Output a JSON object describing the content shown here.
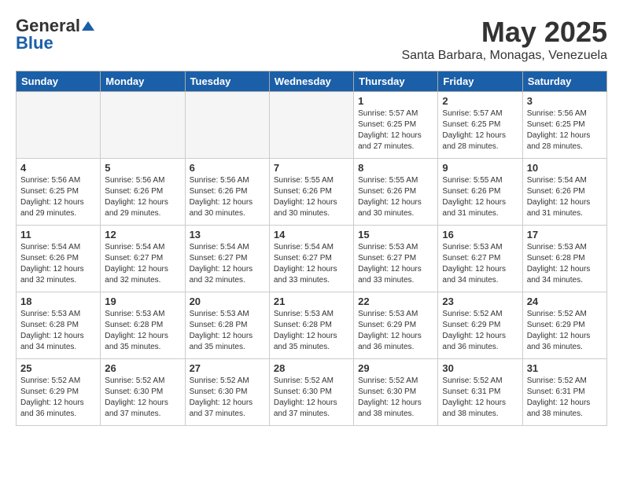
{
  "header": {
    "logo_general": "General",
    "logo_blue": "Blue",
    "month_title": "May 2025",
    "location": "Santa Barbara, Monagas, Venezuela"
  },
  "days_of_week": [
    "Sunday",
    "Monday",
    "Tuesday",
    "Wednesday",
    "Thursday",
    "Friday",
    "Saturday"
  ],
  "weeks": [
    [
      {
        "day": "",
        "info": ""
      },
      {
        "day": "",
        "info": ""
      },
      {
        "day": "",
        "info": ""
      },
      {
        "day": "",
        "info": ""
      },
      {
        "day": "1",
        "info": "Sunrise: 5:57 AM\nSunset: 6:25 PM\nDaylight: 12 hours\nand 27 minutes."
      },
      {
        "day": "2",
        "info": "Sunrise: 5:57 AM\nSunset: 6:25 PM\nDaylight: 12 hours\nand 28 minutes."
      },
      {
        "day": "3",
        "info": "Sunrise: 5:56 AM\nSunset: 6:25 PM\nDaylight: 12 hours\nand 28 minutes."
      }
    ],
    [
      {
        "day": "4",
        "info": "Sunrise: 5:56 AM\nSunset: 6:25 PM\nDaylight: 12 hours\nand 29 minutes."
      },
      {
        "day": "5",
        "info": "Sunrise: 5:56 AM\nSunset: 6:26 PM\nDaylight: 12 hours\nand 29 minutes."
      },
      {
        "day": "6",
        "info": "Sunrise: 5:56 AM\nSunset: 6:26 PM\nDaylight: 12 hours\nand 30 minutes."
      },
      {
        "day": "7",
        "info": "Sunrise: 5:55 AM\nSunset: 6:26 PM\nDaylight: 12 hours\nand 30 minutes."
      },
      {
        "day": "8",
        "info": "Sunrise: 5:55 AM\nSunset: 6:26 PM\nDaylight: 12 hours\nand 30 minutes."
      },
      {
        "day": "9",
        "info": "Sunrise: 5:55 AM\nSunset: 6:26 PM\nDaylight: 12 hours\nand 31 minutes."
      },
      {
        "day": "10",
        "info": "Sunrise: 5:54 AM\nSunset: 6:26 PM\nDaylight: 12 hours\nand 31 minutes."
      }
    ],
    [
      {
        "day": "11",
        "info": "Sunrise: 5:54 AM\nSunset: 6:26 PM\nDaylight: 12 hours\nand 32 minutes."
      },
      {
        "day": "12",
        "info": "Sunrise: 5:54 AM\nSunset: 6:27 PM\nDaylight: 12 hours\nand 32 minutes."
      },
      {
        "day": "13",
        "info": "Sunrise: 5:54 AM\nSunset: 6:27 PM\nDaylight: 12 hours\nand 32 minutes."
      },
      {
        "day": "14",
        "info": "Sunrise: 5:54 AM\nSunset: 6:27 PM\nDaylight: 12 hours\nand 33 minutes."
      },
      {
        "day": "15",
        "info": "Sunrise: 5:53 AM\nSunset: 6:27 PM\nDaylight: 12 hours\nand 33 minutes."
      },
      {
        "day": "16",
        "info": "Sunrise: 5:53 AM\nSunset: 6:27 PM\nDaylight: 12 hours\nand 34 minutes."
      },
      {
        "day": "17",
        "info": "Sunrise: 5:53 AM\nSunset: 6:28 PM\nDaylight: 12 hours\nand 34 minutes."
      }
    ],
    [
      {
        "day": "18",
        "info": "Sunrise: 5:53 AM\nSunset: 6:28 PM\nDaylight: 12 hours\nand 34 minutes."
      },
      {
        "day": "19",
        "info": "Sunrise: 5:53 AM\nSunset: 6:28 PM\nDaylight: 12 hours\nand 35 minutes."
      },
      {
        "day": "20",
        "info": "Sunrise: 5:53 AM\nSunset: 6:28 PM\nDaylight: 12 hours\nand 35 minutes."
      },
      {
        "day": "21",
        "info": "Sunrise: 5:53 AM\nSunset: 6:28 PM\nDaylight: 12 hours\nand 35 minutes."
      },
      {
        "day": "22",
        "info": "Sunrise: 5:53 AM\nSunset: 6:29 PM\nDaylight: 12 hours\nand 36 minutes."
      },
      {
        "day": "23",
        "info": "Sunrise: 5:52 AM\nSunset: 6:29 PM\nDaylight: 12 hours\nand 36 minutes."
      },
      {
        "day": "24",
        "info": "Sunrise: 5:52 AM\nSunset: 6:29 PM\nDaylight: 12 hours\nand 36 minutes."
      }
    ],
    [
      {
        "day": "25",
        "info": "Sunrise: 5:52 AM\nSunset: 6:29 PM\nDaylight: 12 hours\nand 36 minutes."
      },
      {
        "day": "26",
        "info": "Sunrise: 5:52 AM\nSunset: 6:30 PM\nDaylight: 12 hours\nand 37 minutes."
      },
      {
        "day": "27",
        "info": "Sunrise: 5:52 AM\nSunset: 6:30 PM\nDaylight: 12 hours\nand 37 minutes."
      },
      {
        "day": "28",
        "info": "Sunrise: 5:52 AM\nSunset: 6:30 PM\nDaylight: 12 hours\nand 37 minutes."
      },
      {
        "day": "29",
        "info": "Sunrise: 5:52 AM\nSunset: 6:30 PM\nDaylight: 12 hours\nand 38 minutes."
      },
      {
        "day": "30",
        "info": "Sunrise: 5:52 AM\nSunset: 6:31 PM\nDaylight: 12 hours\nand 38 minutes."
      },
      {
        "day": "31",
        "info": "Sunrise: 5:52 AM\nSunset: 6:31 PM\nDaylight: 12 hours\nand 38 minutes."
      }
    ]
  ]
}
